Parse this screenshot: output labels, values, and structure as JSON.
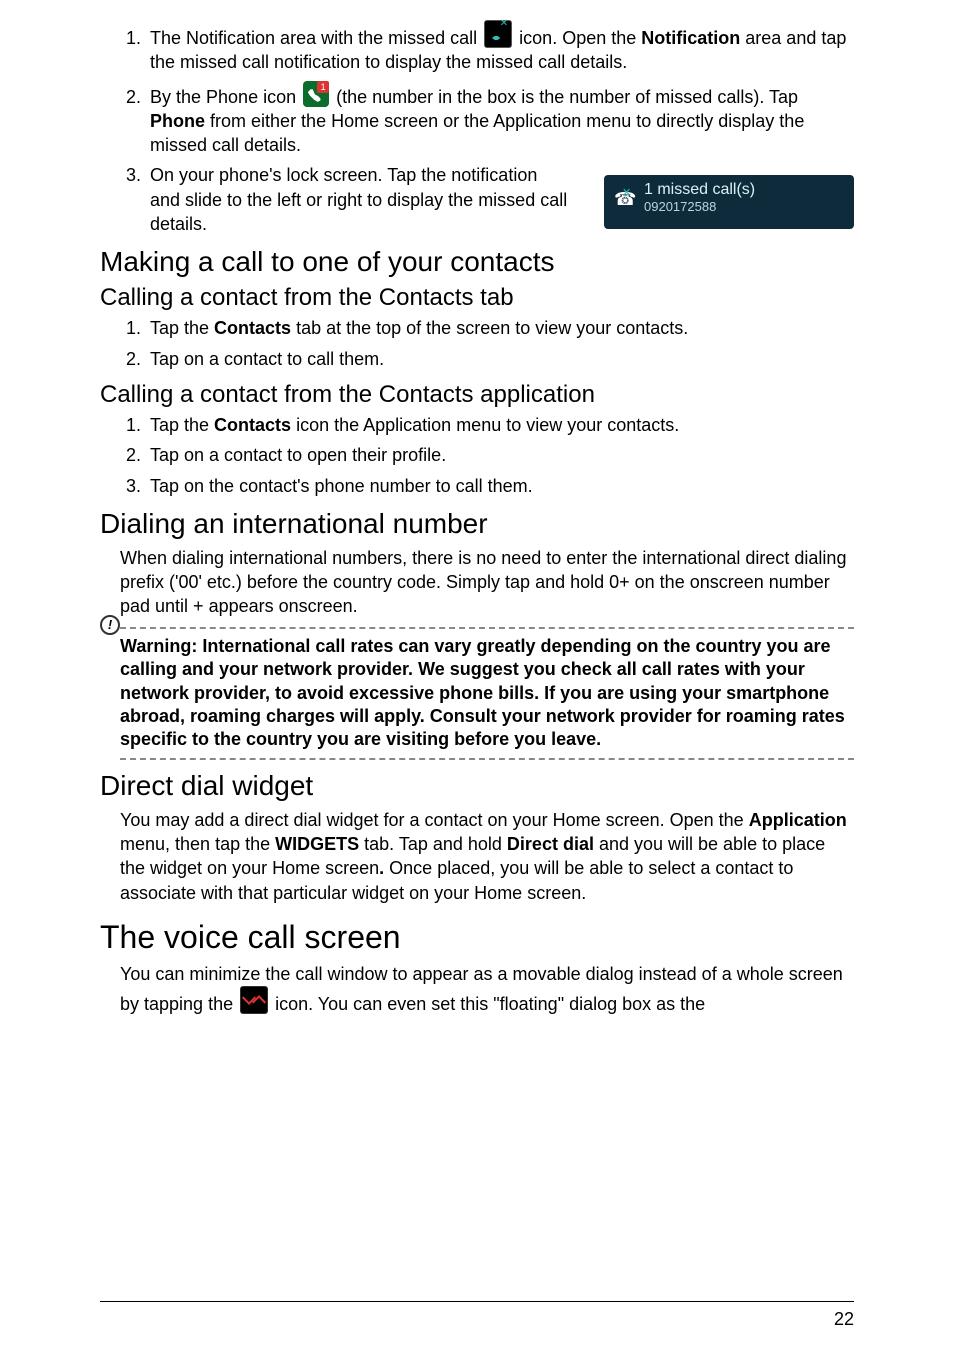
{
  "items_top": {
    "li1_a": "The Notification area with the missed call ",
    "li1_b": " icon. Open the ",
    "li1_bold": "Notification",
    "li1_c": " area and tap the missed call notification to display the missed call details.",
    "li2_a": "By the Phone icon ",
    "li2_b": " (the number in the box is the number of missed calls). Tap ",
    "li2_bold": "Phone",
    "li2_c": " from either the Home screen or the Application menu to directly display the missed call details.",
    "li3": "On your phone's lock screen. Tap the notification and slide to the left or right to display the missed call details."
  },
  "notif": {
    "line1": "1 missed call(s)",
    "line2": "0920172588"
  },
  "sections": {
    "making_call_h2": "Making a call to one of your contacts",
    "contacts_tab_h3": "Calling a contact from the Contacts tab",
    "contacts_tab_li1_a": "Tap the ",
    "contacts_tab_li1_bold": "Contacts",
    "contacts_tab_li1_b": " tab at the top of the screen to view your contacts.",
    "contacts_tab_li2": "Tap on a contact to call them.",
    "contacts_app_h3": "Calling a contact from the Contacts application",
    "contacts_app_li1_a": "Tap the ",
    "contacts_app_li1_bold": "Contacts",
    "contacts_app_li1_b": " icon the Application menu to view your contacts.",
    "contacts_app_li2": "Tap on a contact to open their profile.",
    "contacts_app_li3": "Tap on the contact's phone number to call them.",
    "dialing_h2": "Dialing an international number",
    "dialing_para": "When dialing international numbers, there is no need to enter the international direct dialing prefix ('00' etc.) before the country code. Simply tap and hold 0+ on the onscreen number pad until + appears onscreen.",
    "warning": "Warning: International call rates can vary greatly depending on the country you are calling and your network provider. We suggest you check all call rates with your network provider, to avoid excessive phone bills. If you are using your smartphone abroad, roaming charges will apply. Consult your network provider for roaming rates specific to the country you are visiting before you leave.",
    "direct_dial_h2": "Direct dial widget",
    "dd_a": "You may add a direct dial widget for a contact on your Home screen. Open the ",
    "dd_b1": "Application",
    "dd_c": " menu, then tap the ",
    "dd_b2": "WIDGETS",
    "dd_d": " tab. Tap and hold ",
    "dd_b3": "Direct dial",
    "dd_e": " and you will be able to place the widget on your Home screen",
    "dd_b4": ".",
    "dd_f": " Once placed, you will be able to select a contact to associate with that particular widget on your Home screen.",
    "voice_h1": "The voice call screen",
    "voice_a": "You can minimize the call window to appear as a movable dialog instead of a whole screen by tapping the ",
    "voice_b": " icon. You can even set this \"floating\" dialog box as the"
  },
  "warn_glyph": "!",
  "page_number": "22"
}
